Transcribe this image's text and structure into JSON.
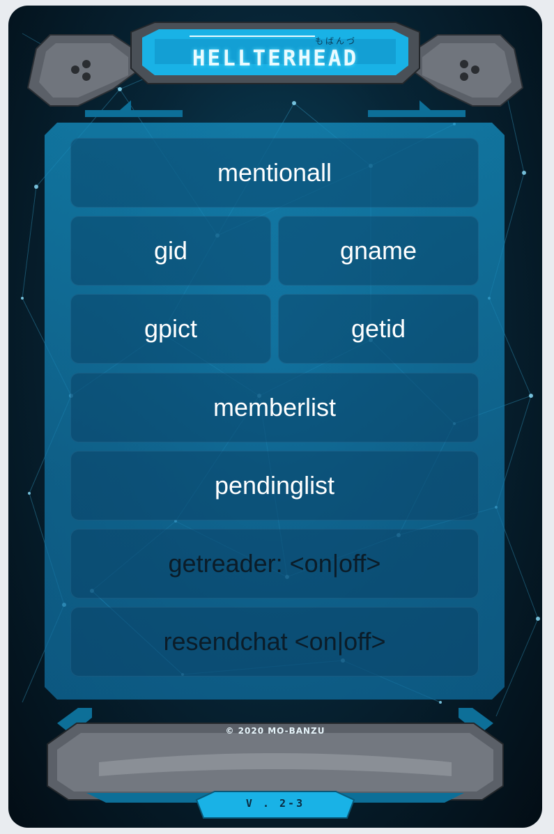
{
  "header": {
    "title": "HELLTERHEAD",
    "subtitle": "もばんづ"
  },
  "menu": {
    "mentionall": "mentionall",
    "gid": "gid",
    "gname": "gname",
    "gpict": "gpict",
    "getid": "getid",
    "memberlist": "memberlist",
    "pendinglist": "pendinglist",
    "getreader": "getreader: <on|off>",
    "resendchat": "resendchat <on|off>"
  },
  "footer": {
    "copyright": "© 2020 MO-BANZU",
    "version": "V . 2-3"
  },
  "colors": {
    "panel": "#1a8cbe",
    "button_bg": "#0e4a6e",
    "accent": "#2cc8f5",
    "frame_metal": "#5a5f66",
    "text_light": "#ffffff",
    "text_dark": "#0b1c28"
  }
}
